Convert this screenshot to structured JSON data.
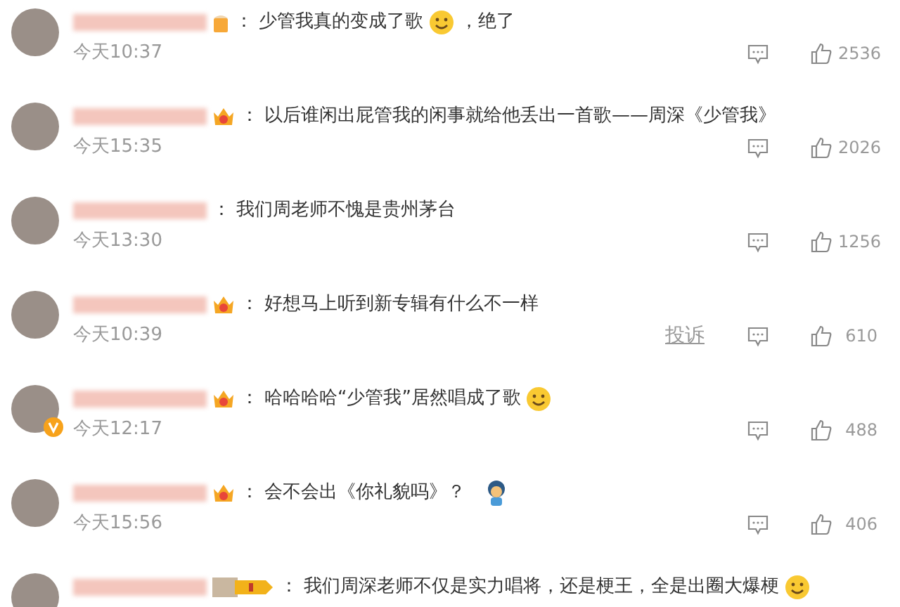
{
  "comments": [
    {
      "verified": false,
      "badge": {
        "kind": "mug"
      },
      "colon": "：",
      "parts": [
        {
          "kind": "text",
          "text": "少管我真的变成了歌"
        },
        {
          "kind": "emoji"
        },
        {
          "kind": "text",
          "text": "，绝了"
        }
      ],
      "time": "今天10:37",
      "likes": "2536"
    },
    {
      "verified": false,
      "badge": {
        "kind": "crown"
      },
      "colon": "：",
      "parts": [
        {
          "kind": "text",
          "text": "以后谁闲出屁管我的闲事就给他丢出一首歌——周深《少管我》"
        }
      ],
      "time": "今天15:35",
      "likes": "2026"
    },
    {
      "verified": false,
      "colon": "：",
      "parts": [
        {
          "kind": "text",
          "text": "我们周老师不愧是贵州茅台"
        }
      ],
      "time": "今天13:30",
      "likes": "1256"
    },
    {
      "verified": false,
      "badge": {
        "kind": "crown"
      },
      "colon": "：",
      "parts": [
        {
          "kind": "text",
          "text": "好想马上听到新专辑有什么不一样"
        }
      ],
      "time": "今天10:39",
      "report": "投诉",
      "likes": "610"
    },
    {
      "verified": true,
      "badge": {
        "kind": "crown"
      },
      "colon": "：",
      "parts": [
        {
          "kind": "text",
          "text": "哈哈哈哈“少管我”居然唱成了歌"
        },
        {
          "kind": "emoji"
        }
      ],
      "time": "今天12:17",
      "likes": "488"
    },
    {
      "verified": false,
      "badge": {
        "kind": "crown"
      },
      "colon": "：",
      "parts": [
        {
          "kind": "text",
          "text": "会不会出《你礼貌吗》？"
        },
        {
          "kind": "sticker"
        }
      ],
      "time": "今天15:56",
      "likes": "406"
    },
    {
      "verified": false,
      "badge": {
        "kind": "level"
      },
      "colon": "：",
      "parts": [
        {
          "kind": "text",
          "text": "我们周深老师不仅是实力唱将，还是梗王，全是出圈大爆梗"
        },
        {
          "kind": "emoji"
        }
      ]
    }
  ]
}
